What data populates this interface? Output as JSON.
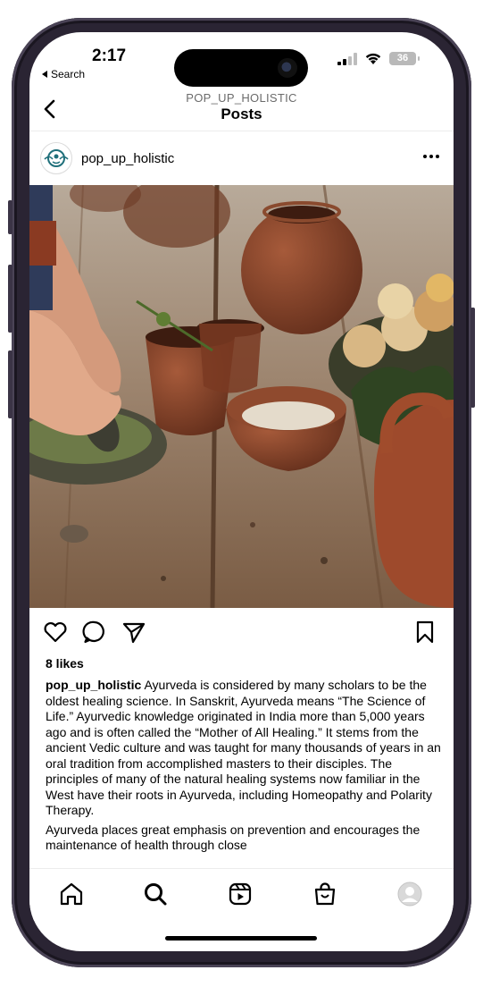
{
  "status_bar": {
    "time": "2:17",
    "back_app": "Search",
    "battery": "36"
  },
  "header": {
    "username": "POP_UP_HOLISTIC",
    "title": "Posts",
    "back_icon": "chevron-left-icon"
  },
  "post": {
    "username": "pop_up_holistic",
    "avatar_icon": "brand-logo",
    "more_icon": "more-horizontal-icon",
    "image_subject": "Clay pots, mortar and pestle with herbs, bowl of grains and onions on a rustic wooden table",
    "likes": "8 likes",
    "caption_user": "pop_up_holistic",
    "caption_text": "Ayurveda is considered by many scholars to be the oldest healing science. In Sanskrit, Ayurveda means “The Science of Life.” Ayurvedic knowledge originated in India more than 5,000 years ago and is often called the “Mother of All Healing.” It stems from the ancient Vedic culture and was taught for many thousands of years in an oral tradition from accomplished masters to their disciples. The principles of many of the natural healing systems now familiar in the West have their roots in Ayurveda, including Homeopathy and Polarity Therapy.",
    "caption_text_2": "Ayurveda places great emphasis on prevention and encourages the maintenance of health through close"
  },
  "actions": {
    "like_icon": "heart-icon",
    "comment_icon": "comment-icon",
    "share_icon": "send-icon",
    "save_icon": "bookmark-icon"
  },
  "tabbar": {
    "items": [
      "home-icon",
      "search-icon",
      "reels-icon",
      "shop-icon",
      "profile-icon"
    ]
  },
  "colors": {
    "text": "#000000",
    "secondary": "#6b6b6b",
    "divider": "#ececec",
    "frame": "#2a2433"
  }
}
